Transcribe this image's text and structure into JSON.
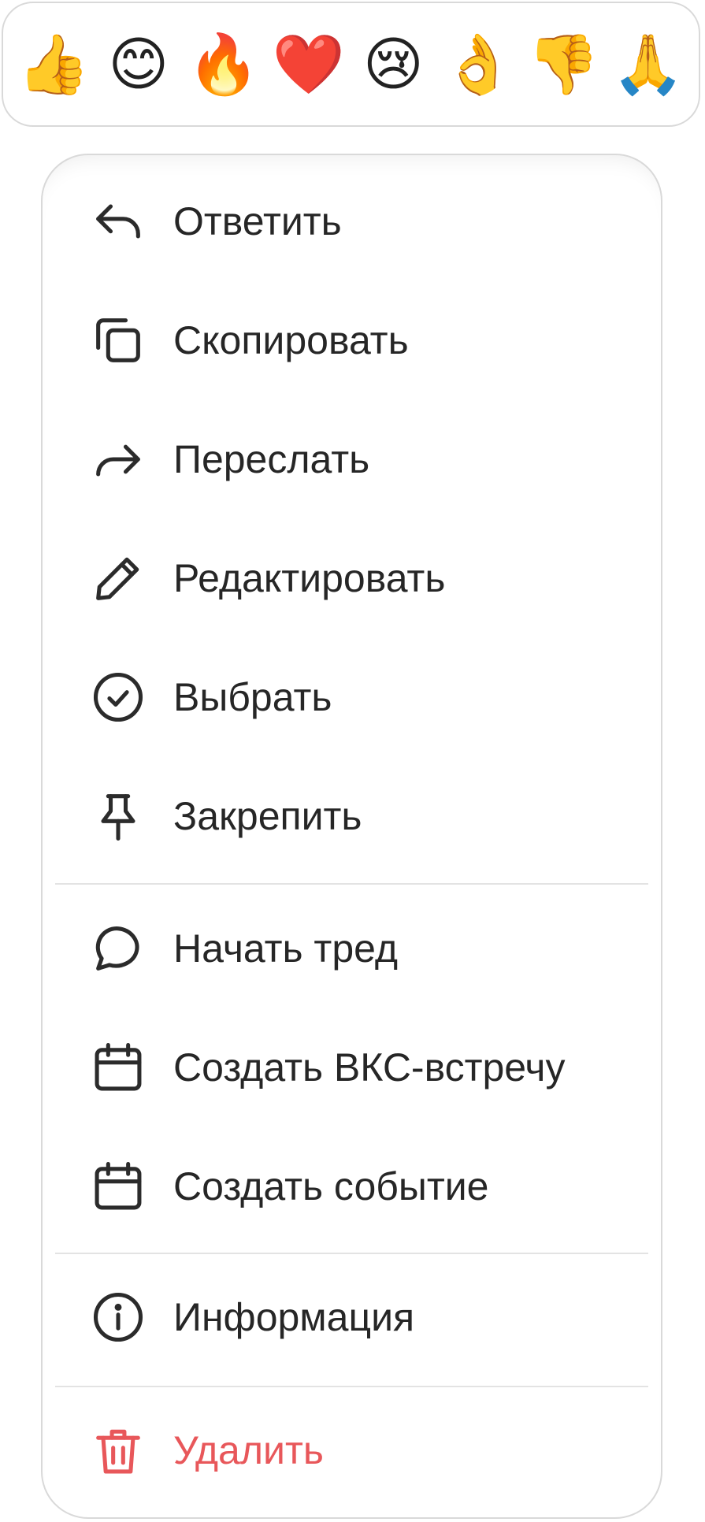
{
  "reactions": [
    {
      "emoji": "👍",
      "name": "thumbs-up-reaction"
    },
    {
      "emoji": "😊",
      "name": "smile-reaction"
    },
    {
      "emoji": "🔥",
      "name": "fire-reaction"
    },
    {
      "emoji": "❤️",
      "name": "heart-reaction"
    },
    {
      "emoji": "😢",
      "name": "cry-reaction"
    },
    {
      "emoji": "👌",
      "name": "ok-hand-reaction"
    },
    {
      "emoji": "👎",
      "name": "thumbs-down-reaction"
    },
    {
      "emoji": "🙏",
      "name": "pray-reaction"
    }
  ],
  "menu": {
    "items": [
      {
        "label": "Ответить",
        "icon": "reply-icon"
      },
      {
        "label": "Скопировать",
        "icon": "copy-icon"
      },
      {
        "label": "Переслать",
        "icon": "forward-icon"
      },
      {
        "label": "Редактировать",
        "icon": "pencil-icon"
      },
      {
        "label": "Выбрать",
        "icon": "check-circle-icon"
      },
      {
        "label": "Закрепить",
        "icon": "pin-icon"
      },
      {
        "label": "Начать тред",
        "icon": "chat-bubble-icon"
      },
      {
        "label": "Создать ВКС-встречу",
        "icon": "calendar-icon"
      },
      {
        "label": "Создать событие",
        "icon": "calendar-icon"
      },
      {
        "label": "Информация",
        "icon": "info-icon"
      },
      {
        "label": "Удалить",
        "icon": "trash-icon"
      }
    ]
  },
  "colors": {
    "text": "#262626",
    "icon": "#2b2b2b",
    "danger": "#e8575a",
    "border": "#d9d9d9",
    "divider": "#e3e3e3"
  }
}
